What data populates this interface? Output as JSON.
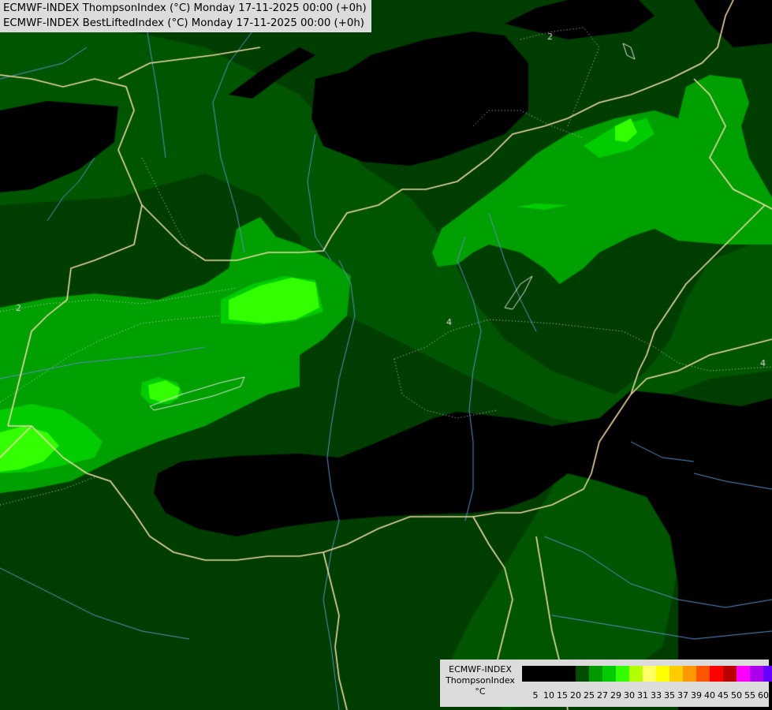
{
  "titles": [
    "ECMWF-INDEX ThompsonIndex (°C) Monday 17-11-2025 00:00 (+0h)",
    "ECMWF-INDEX BestLiftedIndex (°C) Monday 17-11-2025 00:00 (+0h)"
  ],
  "legend": {
    "lines": [
      "ECMWF-INDEX",
      "ThompsonIndex",
      "°C"
    ],
    "ticks": [
      "5",
      "10",
      "15",
      "20",
      "25",
      "27",
      "29",
      "30",
      "31",
      "33",
      "35",
      "37",
      "39",
      "40",
      "45",
      "50",
      "55",
      "60"
    ],
    "colors": [
      "#000000",
      "#000000",
      "#000000",
      "#000000",
      "#004d00",
      "#009a00",
      "#00cc00",
      "#33ff00",
      "#b4ff00",
      "#ffff66",
      "#ffff00",
      "#ffcc00",
      "#ff9900",
      "#ff5500",
      "#ff0000",
      "#bb0000",
      "#ff00ff",
      "#aa00ee",
      "#6600ff",
      "#0000ff"
    ]
  },
  "contour_labels": [
    "2",
    "2",
    "4",
    "4"
  ],
  "map_colors": {
    "background": "#003d00",
    "band_25": "#005500",
    "band_27": "#00a000",
    "band_29": "#00cc00",
    "band_30": "#33ff00",
    "black": "#000000",
    "border": "#f0d9a8",
    "river": "#5a8fc8",
    "contour": "#d8d8d8"
  }
}
